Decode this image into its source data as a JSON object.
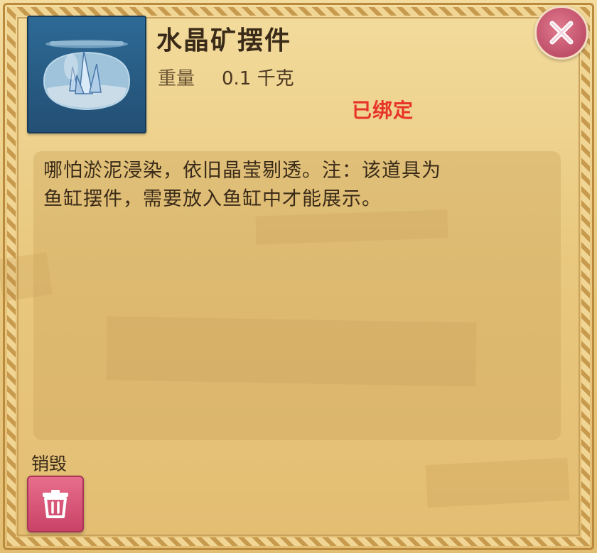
{
  "item": {
    "name": "水晶矿摆件",
    "weight_label": "重量",
    "weight_value": "0.1 千克",
    "bound_status": "已绑定",
    "description": "哪怕淤泥浸染，依旧晶莹剔透。注：该道具为\n鱼缸摆件，需要放入鱼缸中才能展示。",
    "icon": "crystal-fishbowl-icon"
  },
  "actions": {
    "destroy_label": "销毁",
    "destroy_icon": "trash-can-icon",
    "close_icon": "close-icon"
  },
  "colors": {
    "bound_text": "#e8332a",
    "close_button": "#c44a68",
    "destroy_button": "#d4507a",
    "panel_bg": "#f0d594"
  }
}
